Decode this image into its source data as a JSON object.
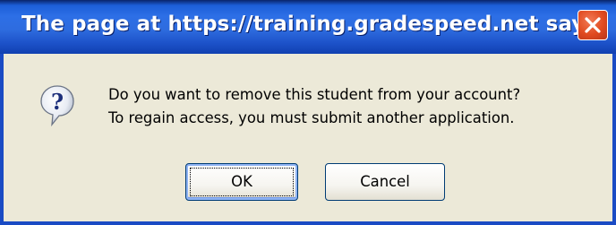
{
  "dialog": {
    "title": "The page at https://training.gradespeed.net says:",
    "icon": "question-icon",
    "message_lines": [
      "Do you want to remove this student from your account?",
      "To regain access, you must submit another application."
    ],
    "buttons": {
      "ok_label": "OK",
      "cancel_label": "Cancel"
    }
  },
  "colors": {
    "titlebar_blue": "#2D6FE6",
    "dialog_background": "#ECE9D8",
    "close_red": "#E04A1F",
    "button_border": "#003C74"
  }
}
